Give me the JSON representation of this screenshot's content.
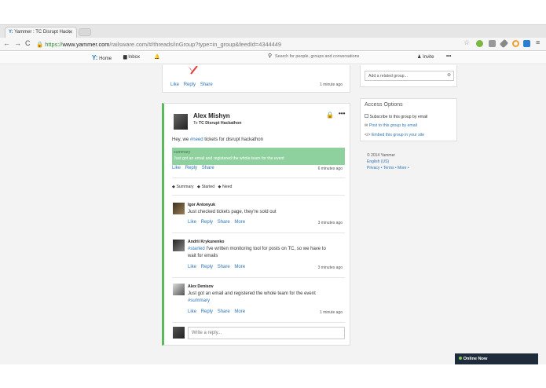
{
  "browser": {
    "tab_title": "Yammer : TC Disrupt Hack",
    "url_https": "https://",
    "url_host": "www.yammer.com",
    "url_rest": "/railsware.com/#/threads/inGroup?type=in_group&feedId=4344449"
  },
  "header": {
    "home_label": "Home",
    "inbox_label": "Inbox",
    "search_placeholder": "Search for people, groups and conversations",
    "invite_label": "Invite",
    "more_label": "•••"
  },
  "prev_post": {
    "like": "Like",
    "reply": "Reply",
    "share": "Share",
    "time": "1 minute ago"
  },
  "thread": {
    "author": "Alex Mishyn",
    "to_prefix": "To",
    "group": "TC Disrupt Hackathon",
    "text_before": "Hey, we ",
    "hashtag": "#need",
    "text_after": " tickets for disrupt hackathon",
    "highlight_title": "summary",
    "highlight_text": "Just got an email and registered the whole team for the event",
    "like": "Like",
    "reply": "Reply",
    "share": "Share",
    "time": "6 minutes ago",
    "tags": [
      "Summary",
      "Started",
      "Need"
    ]
  },
  "replies": [
    {
      "author": "Igor Antonyuk",
      "text": "Just checked tickets page, they're sold out",
      "actions": [
        "Like",
        "Reply",
        "Share",
        "More"
      ],
      "time": "3 minutes ago"
    },
    {
      "author": "Andrii Krykunenko",
      "hashtag": "#started",
      "text": " I've written monitoring tool for posts on TC, so we have to",
      "text2": "wait for emails",
      "actions": [
        "Like",
        "Reply",
        "Share",
        "More"
      ],
      "time": "3 minutes ago"
    },
    {
      "author": "Alex Denisov",
      "text": "Just got an email and registered the whole team for the event",
      "hashtag": "#summary",
      "actions": [
        "Like",
        "Reply",
        "Share",
        "More"
      ],
      "time": "1 minute ago"
    }
  ],
  "reply_box": {
    "placeholder": "Write a reply..."
  },
  "sidebar": {
    "related_placeholder": "Add a related group...",
    "access_title": "Access Options",
    "subscribe_label": "Subscribe to this group by email",
    "post_label": "Post to this group by email",
    "embed_label": "Embed this group in your site",
    "copyright": "© 2014 Yammer",
    "language": "English (US)",
    "footer_privacy": "Privacy",
    "footer_terms": "Terms",
    "footer_more": "More",
    "footer_sep": "•"
  },
  "online_now": {
    "label": "Online Now"
  },
  "colors": {
    "link": "#2f76b5",
    "highlight_bg": "#8fd19e",
    "thread_accent": "#5cb85c",
    "online_bar": "#1d2b3a"
  }
}
